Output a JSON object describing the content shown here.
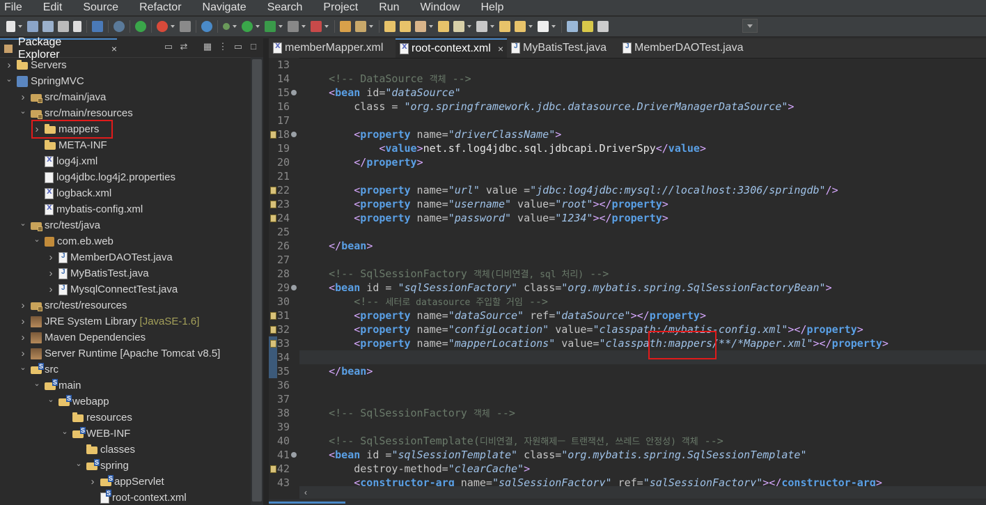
{
  "menu": [
    "File",
    "Edit",
    "Source",
    "Refactor",
    "Navigate",
    "Search",
    "Project",
    "Run",
    "Window",
    "Help"
  ],
  "explorer": {
    "title": "Package Explorer",
    "close_glyph": "×",
    "tree": [
      {
        "label": "Servers",
        "icon": "folder",
        "depth": 0,
        "twisty": "collapsed"
      },
      {
        "label": "SpringMVC",
        "icon": "project",
        "depth": 0,
        "twisty": "expanded"
      },
      {
        "label": "src/main/java",
        "icon": "pkgfolder",
        "depth": 1,
        "twisty": "collapsed"
      },
      {
        "label": "src/main/resources",
        "icon": "pkgfolder",
        "depth": 1,
        "twisty": "expanded"
      },
      {
        "label": "mappers",
        "icon": "folder",
        "depth": 2,
        "twisty": "collapsed",
        "highlighted": true
      },
      {
        "label": "META-INF",
        "icon": "folder",
        "depth": 2,
        "twisty": "none"
      },
      {
        "label": "log4j.xml",
        "icon": "xml",
        "depth": 2,
        "twisty": "none"
      },
      {
        "label": "log4jdbc.log4j2.properties",
        "icon": "file",
        "depth": 2,
        "twisty": "none"
      },
      {
        "label": "logback.xml",
        "icon": "xml",
        "depth": 2,
        "twisty": "none"
      },
      {
        "label": "mybatis-config.xml",
        "icon": "xml",
        "depth": 2,
        "twisty": "none"
      },
      {
        "label": "src/test/java",
        "icon": "pkgfolder",
        "depth": 1,
        "twisty": "expanded"
      },
      {
        "label": "com.eb.web",
        "icon": "pkg",
        "depth": 2,
        "twisty": "expanded"
      },
      {
        "label": "MemberDAOTest.java",
        "icon": "java",
        "depth": 3,
        "twisty": "collapsed"
      },
      {
        "label": "MyBatisTest.java",
        "icon": "java",
        "depth": 3,
        "twisty": "collapsed"
      },
      {
        "label": "MysqlConnectTest.java",
        "icon": "java",
        "depth": 3,
        "twisty": "collapsed"
      },
      {
        "label": "src/test/resources",
        "icon": "pkgfolder",
        "depth": 1,
        "twisty": "collapsed"
      },
      {
        "label": "JRE System Library",
        "icon": "lib",
        "depth": 1,
        "twisty": "collapsed",
        "decoration": "[JavaSE-1.6]"
      },
      {
        "label": "Maven Dependencies",
        "icon": "lib",
        "depth": 1,
        "twisty": "collapsed"
      },
      {
        "label": "Server Runtime [Apache Tomcat v8.5]",
        "icon": "lib",
        "depth": 1,
        "twisty": "collapsed"
      },
      {
        "label": "src",
        "icon": "srvfolder",
        "depth": 1,
        "twisty": "expanded"
      },
      {
        "label": "main",
        "icon": "srvfolder",
        "depth": 2,
        "twisty": "expanded"
      },
      {
        "label": "webapp",
        "icon": "srvfolder",
        "depth": 3,
        "twisty": "expanded"
      },
      {
        "label": "resources",
        "icon": "folder",
        "depth": 4,
        "twisty": "none"
      },
      {
        "label": "WEB-INF",
        "icon": "srvfolder",
        "depth": 4,
        "twisty": "expanded"
      },
      {
        "label": "classes",
        "icon": "folder",
        "depth": 5,
        "twisty": "none"
      },
      {
        "label": "spring",
        "icon": "srvfolder",
        "depth": 5,
        "twisty": "expanded"
      },
      {
        "label": "appServlet",
        "icon": "srvfolder",
        "depth": 6,
        "twisty": "collapsed"
      },
      {
        "label": "root-context.xml",
        "icon": "xmlS",
        "depth": 6,
        "twisty": "none"
      }
    ]
  },
  "editor": {
    "tabs": [
      {
        "label": "memberMapper.xml",
        "active": false
      },
      {
        "label": "root-context.xml",
        "active": true
      },
      {
        "label": "MyBatisTest.java",
        "active": false
      },
      {
        "label": "MemberDAOTest.java",
        "active": false
      }
    ],
    "close_glyph": "×",
    "first_line": 13,
    "current_line": 34,
    "lines": [
      {
        "n": 13,
        "fold": false,
        "marker": false,
        "parts": []
      },
      {
        "n": 14,
        "fold": false,
        "marker": false,
        "parts": [
          [
            "    ",
            "t"
          ],
          [
            "<!-- DataSource ",
            "c"
          ],
          [
            "객체",
            "k"
          ],
          [
            " -->",
            "c"
          ]
        ]
      },
      {
        "n": 15,
        "fold": true,
        "marker": false,
        "parts": [
          [
            "    ",
            "t"
          ],
          [
            "<",
            "g"
          ],
          [
            "bean",
            "n"
          ],
          [
            " id=",
            "a"
          ],
          [
            "\"dataSource\"",
            "v"
          ]
        ]
      },
      {
        "n": 16,
        "fold": false,
        "marker": false,
        "parts": [
          [
            "        ",
            "t"
          ],
          [
            "class = ",
            "a"
          ],
          [
            "\"org.springframework.jdbc.datasource.DriverManagerDataSource\"",
            "v"
          ],
          [
            ">",
            "g"
          ]
        ]
      },
      {
        "n": 17,
        "fold": false,
        "marker": false,
        "parts": []
      },
      {
        "n": 18,
        "fold": true,
        "marker": true,
        "parts": [
          [
            "        ",
            "t"
          ],
          [
            "<",
            "g"
          ],
          [
            "property",
            "n"
          ],
          [
            " name=",
            "a"
          ],
          [
            "\"driverClassName\"",
            "v"
          ],
          [
            ">",
            "g"
          ]
        ]
      },
      {
        "n": 19,
        "fold": false,
        "marker": false,
        "parts": [
          [
            "            ",
            "t"
          ],
          [
            "<",
            "g"
          ],
          [
            "value",
            "n"
          ],
          [
            ">",
            "g"
          ],
          [
            "net.sf.log4jdbc.sql.jdbcapi.DriverSpy",
            "t"
          ],
          [
            "</",
            "g"
          ],
          [
            "value",
            "n"
          ],
          [
            ">",
            "g"
          ]
        ]
      },
      {
        "n": 20,
        "fold": false,
        "marker": false,
        "parts": [
          [
            "        ",
            "t"
          ],
          [
            "</",
            "g"
          ],
          [
            "property",
            "n"
          ],
          [
            ">",
            "g"
          ]
        ]
      },
      {
        "n": 21,
        "fold": false,
        "marker": false,
        "parts": []
      },
      {
        "n": 22,
        "fold": false,
        "marker": true,
        "parts": [
          [
            "        ",
            "t"
          ],
          [
            "<",
            "g"
          ],
          [
            "property",
            "n"
          ],
          [
            " name=",
            "a"
          ],
          [
            "\"url\"",
            "v"
          ],
          [
            " value =",
            "a"
          ],
          [
            "\"jdbc:log4jdbc:mysql://localhost:3306/springdb\"",
            "v"
          ],
          [
            "/>",
            "g"
          ]
        ]
      },
      {
        "n": 23,
        "fold": false,
        "marker": true,
        "parts": [
          [
            "        ",
            "t"
          ],
          [
            "<",
            "g"
          ],
          [
            "property",
            "n"
          ],
          [
            " name=",
            "a"
          ],
          [
            "\"username\"",
            "v"
          ],
          [
            " value=",
            "a"
          ],
          [
            "\"root\"",
            "v"
          ],
          [
            "></",
            "g"
          ],
          [
            "property",
            "n"
          ],
          [
            ">",
            "g"
          ]
        ]
      },
      {
        "n": 24,
        "fold": false,
        "marker": true,
        "parts": [
          [
            "        ",
            "t"
          ],
          [
            "<",
            "g"
          ],
          [
            "property",
            "n"
          ],
          [
            " name=",
            "a"
          ],
          [
            "\"password\"",
            "v"
          ],
          [
            " value=",
            "a"
          ],
          [
            "\"1234\"",
            "v"
          ],
          [
            "></",
            "g"
          ],
          [
            "property",
            "n"
          ],
          [
            ">",
            "g"
          ]
        ]
      },
      {
        "n": 25,
        "fold": false,
        "marker": false,
        "parts": []
      },
      {
        "n": 26,
        "fold": false,
        "marker": false,
        "parts": [
          [
            "    ",
            "t"
          ],
          [
            "</",
            "g"
          ],
          [
            "bean",
            "n"
          ],
          [
            ">",
            "g"
          ]
        ]
      },
      {
        "n": 27,
        "fold": false,
        "marker": false,
        "parts": []
      },
      {
        "n": 28,
        "fold": false,
        "marker": false,
        "parts": [
          [
            "    ",
            "t"
          ],
          [
            "<!-- SqlSessionFactory ",
            "c"
          ],
          [
            "객체(디비연결, sql 처리)",
            "k"
          ],
          [
            " -->",
            "c"
          ]
        ]
      },
      {
        "n": 29,
        "fold": true,
        "marker": false,
        "parts": [
          [
            "    ",
            "t"
          ],
          [
            "<",
            "g"
          ],
          [
            "bean",
            "n"
          ],
          [
            " id = ",
            "a"
          ],
          [
            "\"sqlSessionFactory\"",
            "v"
          ],
          [
            " class=",
            "a"
          ],
          [
            "\"org.mybatis.spring.SqlSessionFactoryBean\"",
            "v"
          ],
          [
            ">",
            "g"
          ]
        ]
      },
      {
        "n": 30,
        "fold": false,
        "marker": false,
        "parts": [
          [
            "        ",
            "t"
          ],
          [
            "<!-- ",
            "c"
          ],
          [
            "세터로 datasource 주입할 거임",
            "k"
          ],
          [
            " -->",
            "c"
          ]
        ]
      },
      {
        "n": 31,
        "fold": false,
        "marker": true,
        "parts": [
          [
            "        ",
            "t"
          ],
          [
            "<",
            "g"
          ],
          [
            "property",
            "n"
          ],
          [
            " name=",
            "a"
          ],
          [
            "\"dataSource\"",
            "v"
          ],
          [
            " ref=",
            "a"
          ],
          [
            "\"dataSource\"",
            "v"
          ],
          [
            "></",
            "g"
          ],
          [
            "property",
            "n"
          ],
          [
            ">",
            "g"
          ]
        ]
      },
      {
        "n": 32,
        "fold": false,
        "marker": true,
        "parts": [
          [
            "        ",
            "t"
          ],
          [
            "<",
            "g"
          ],
          [
            "property",
            "n"
          ],
          [
            " name=",
            "a"
          ],
          [
            "\"configLocation\"",
            "v"
          ],
          [
            " value=",
            "a"
          ],
          [
            "\"classpath:/mybatis-config.xml\"",
            "v"
          ],
          [
            "></",
            "g"
          ],
          [
            "property",
            "n"
          ],
          [
            ">",
            "g"
          ]
        ]
      },
      {
        "n": 33,
        "fold": false,
        "marker": true,
        "parts": [
          [
            "        ",
            "t"
          ],
          [
            "<",
            "g"
          ],
          [
            "property",
            "n"
          ],
          [
            " name=",
            "a"
          ],
          [
            "\"mapperLocations\"",
            "v"
          ],
          [
            " value=",
            "a"
          ],
          [
            "\"classpath:mappers/**/*Mapper.xml\"",
            "v"
          ],
          [
            "></",
            "g"
          ],
          [
            "property",
            "n"
          ],
          [
            ">",
            "g"
          ]
        ]
      },
      {
        "n": 34,
        "fold": false,
        "marker": false,
        "parts": []
      },
      {
        "n": 35,
        "fold": false,
        "marker": false,
        "parts": [
          [
            "    ",
            "t"
          ],
          [
            "</",
            "g"
          ],
          [
            "bean",
            "n"
          ],
          [
            ">",
            "g"
          ]
        ]
      },
      {
        "n": 36,
        "fold": false,
        "marker": false,
        "parts": []
      },
      {
        "n": 37,
        "fold": false,
        "marker": false,
        "parts": []
      },
      {
        "n": 38,
        "fold": false,
        "marker": false,
        "parts": [
          [
            "    ",
            "t"
          ],
          [
            "<!-- SqlSessionFactory ",
            "c"
          ],
          [
            "객체",
            "k"
          ],
          [
            " -->",
            "c"
          ]
        ]
      },
      {
        "n": 39,
        "fold": false,
        "marker": false,
        "parts": []
      },
      {
        "n": 40,
        "fold": false,
        "marker": false,
        "parts": [
          [
            "    ",
            "t"
          ],
          [
            "<!-- SqlSessionTemplate(",
            "c"
          ],
          [
            "디비연결, 자원해제ㅡ 트랜잭션, 쓰레드 안정성) 객체",
            "k"
          ],
          [
            " -->",
            "c"
          ]
        ]
      },
      {
        "n": 41,
        "fold": true,
        "marker": false,
        "parts": [
          [
            "    ",
            "t"
          ],
          [
            "<",
            "g"
          ],
          [
            "bean",
            "n"
          ],
          [
            " id =",
            "a"
          ],
          [
            "\"sqlSessionTemplate\"",
            "v"
          ],
          [
            " class=",
            "a"
          ],
          [
            "\"org.mybatis.spring.SqlSessionTemplate\"",
            "v"
          ]
        ]
      },
      {
        "n": 42,
        "fold": false,
        "marker": true,
        "parts": [
          [
            "        ",
            "t"
          ],
          [
            "destroy-method=",
            "a"
          ],
          [
            "\"clearCache\"",
            "v"
          ],
          [
            ">",
            "g"
          ]
        ]
      },
      {
        "n": 43,
        "fold": false,
        "marker": false,
        "parts": [
          [
            "        ",
            "t"
          ],
          [
            "<",
            "g"
          ],
          [
            "constructor-arg",
            "n"
          ],
          [
            " name=",
            "a"
          ],
          [
            "\"sqlSessionFactory\"",
            "v"
          ],
          [
            " ref=",
            "a"
          ],
          [
            "\"sqlSessionFactory\"",
            "v"
          ],
          [
            "></",
            "g"
          ],
          [
            "constructor-arg",
            "n"
          ],
          [
            ">",
            "g"
          ]
        ]
      }
    ]
  },
  "scroll_left_glyph": "‹"
}
